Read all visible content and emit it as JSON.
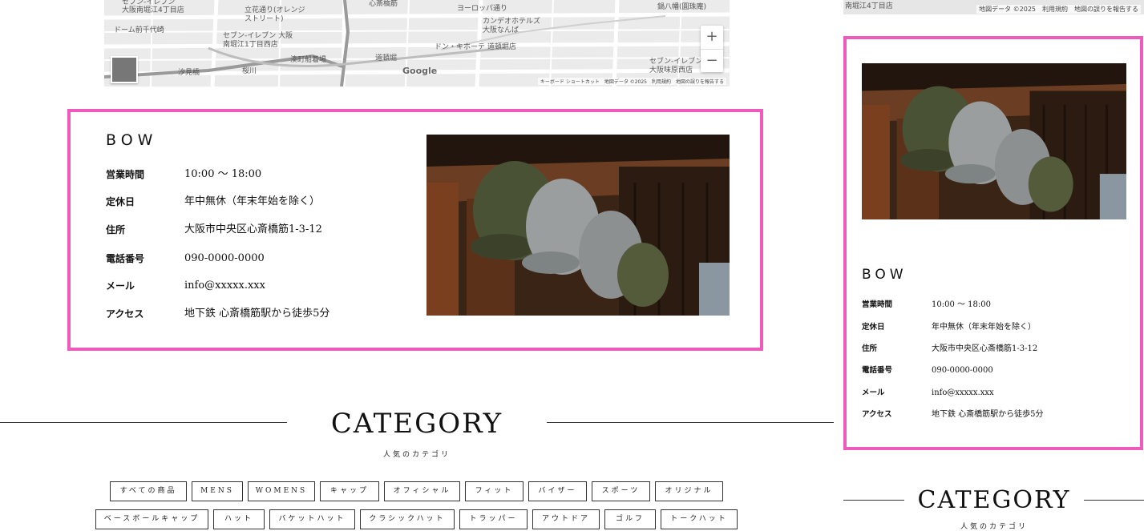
{
  "map": {
    "labels": [
      "セブン-イレブン",
      "大阪南堀江4丁目店",
      "立花通り(オレンジ",
      "ストリート)",
      "心斎橋筋",
      "ヨーロッパ通り",
      "カンデオホテルズ",
      "大阪なんば",
      "ドーム前千代崎",
      "セブン-イレブン 大阪",
      "南堀江1丁目西店",
      "湊町船着場",
      "道頓堀",
      "ドン・キホーテ 道頓堀店",
      "汐見橋",
      "桜川",
      "鍋八幡(圓珠庵)",
      "セブン-イレブン",
      "大阪味原西店"
    ],
    "google": "Google",
    "footer": "キーボード ショートカット　地図データ ©2025　利用規約　地図の誤りを報告する",
    "zoom_in": "+",
    "zoom_out": "−"
  },
  "mobile_map": {
    "footer": "地図データ ©2025　利用規約　地図の誤りを報告する",
    "left_label": "南堀江4丁目店"
  },
  "store": {
    "logo": "BOW",
    "info": [
      {
        "label": "営業時間",
        "value": "10:00 ～ 18:00"
      },
      {
        "label": "定休日",
        "value": "年中無休（年末年始を除く）"
      },
      {
        "label": "住所",
        "value": "大阪市中央区心斎橋筋1-3-12"
      },
      {
        "label": "電話番号",
        "value": "090-0000-0000"
      },
      {
        "label": "メール",
        "value": "info@xxxxx.xxx"
      },
      {
        "label": "アクセス",
        "value": "地下鉄 心斎橋筋駅から徒歩5分"
      }
    ],
    "accent": "#ee5bbd"
  },
  "category": {
    "title": "CATEGORY",
    "subtitle": "人気のカテゴリ",
    "row1": [
      "すべての商品",
      "MENS",
      "WOMENS",
      "キャップ",
      "オフィシャル",
      "フィット",
      "バイザー",
      "スポーツ",
      "オリジナル"
    ],
    "row2": [
      "ベースボールキャップ",
      "ハット",
      "バケットハット",
      "クラシックハット",
      "トラッパー",
      "アウトドア",
      "ゴルフ",
      "トークハット"
    ]
  },
  "mobile_category": {
    "title": "CATEGORY",
    "subtitle": "人気のカテゴリ"
  }
}
